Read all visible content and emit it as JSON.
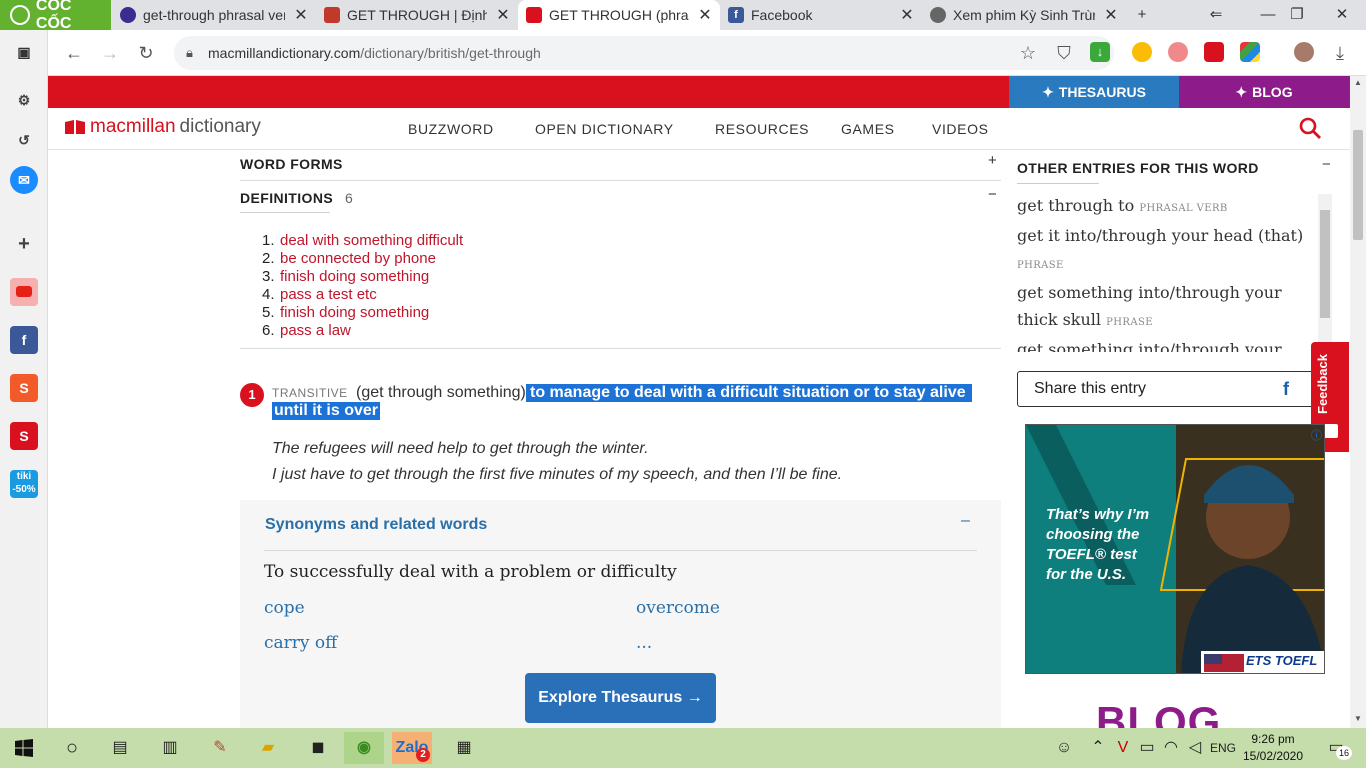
{
  "browser": {
    "brand": "CỐC CỐC",
    "tabs": [
      {
        "title": "get-through phrasal ver"
      },
      {
        "title": "GET THROUGH | Định n"
      },
      {
        "title": "GET THROUGH (phrasal"
      },
      {
        "title": "Facebook"
      },
      {
        "title": "Xem phim Kỳ Sinh Trùn"
      }
    ],
    "url_host": "macmillandictionary.com",
    "url_path": "/dictionary/british/get-through"
  },
  "site": {
    "thesaurus_link": "THESAURUS",
    "blog_link": "BLOG",
    "logo_part1": "macmillan",
    "logo_part2": "dictionary",
    "nav": [
      "BUZZWORD",
      "OPEN DICTIONARY",
      "RESOURCES",
      "GAMES",
      "VIDEOS"
    ]
  },
  "entry": {
    "word_forms_label": "WORD FORMS",
    "word_forms_toggle": "+",
    "definitions_label": "DEFINITIONS",
    "definitions_count": "6",
    "definitions_toggle": "−",
    "definitions": [
      {
        "n": "1.",
        "text": "deal with something difficult"
      },
      {
        "n": "2.",
        "text": "be connected by phone"
      },
      {
        "n": "3.",
        "text": "finish doing something"
      },
      {
        "n": "4.",
        "text": "pass a test etc"
      },
      {
        "n": "5.",
        "text": "finish doing something"
      },
      {
        "n": "6.",
        "text": "pass a law"
      }
    ],
    "sense_number": "1",
    "grammar": "TRANSITIVE",
    "pattern": "(get through something)",
    "definition_line1": " to manage to deal with a difficult situation or to stay alive",
    "definition_line2": "until it is over",
    "examples": [
      "The refugees will need help to get through the winter.",
      "I just have to get through the first five minutes of my speech, and then I’ll be fine."
    ]
  },
  "synonyms": {
    "title": "Synonyms and related words",
    "toggle": "–",
    "sense": "To successfully deal with a problem or difficulty",
    "words": [
      "cope",
      "overcome",
      "carry off",
      "..."
    ],
    "button": "Explore Thesaurus →"
  },
  "sidebar": {
    "other_entries_title": "OTHER ENTRIES FOR THIS WORD",
    "other_entries_toggle": "−",
    "entries": [
      {
        "text": "get through to",
        "pos": "PHRASAL VERB"
      },
      {
        "text": "get it into/through your head (that)",
        "pos": "PHRASE"
      },
      {
        "text": "get something into/through your thick skull",
        "pos": "PHRASE"
      },
      {
        "text": "get something into/through your",
        "pos": ""
      }
    ],
    "share_label": "Share this entry",
    "feedback_label": "Feedback",
    "ad_text": [
      "That’s why I’m",
      "choosing the",
      "TOEFL® test",
      "for the U.S."
    ],
    "ad_brand": "ETS TOEFL",
    "blog_heading": "BLOG"
  },
  "taskbar": {
    "time": "9:26 pm",
    "date": "15/02/2020",
    "lang": "ENG",
    "notif_count": "16",
    "zalo_badge": "2"
  }
}
